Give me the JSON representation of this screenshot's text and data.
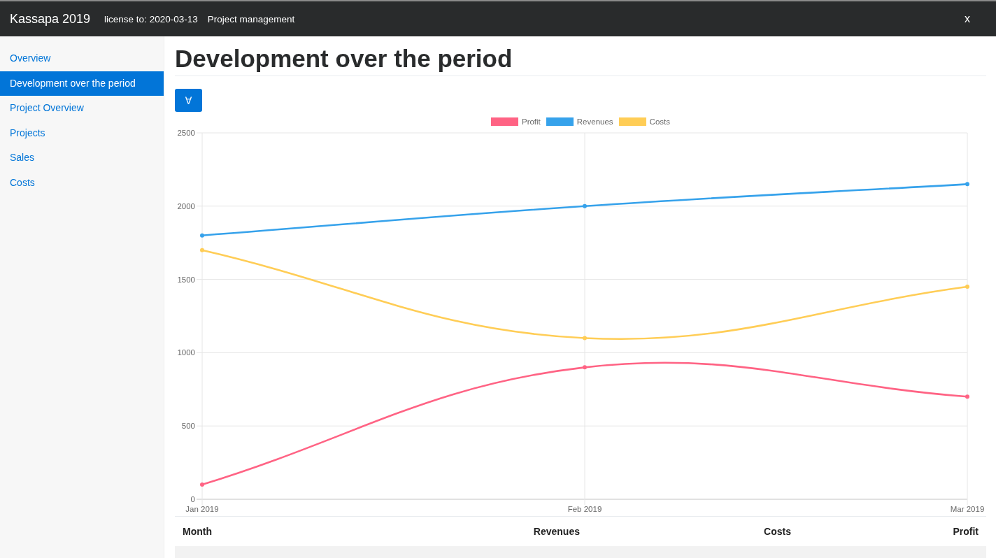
{
  "window": {
    "brand": "Kassapa 2019",
    "license": "license to: 2020-03-13",
    "module": "Project management",
    "close": "x"
  },
  "sidebar": {
    "items": [
      {
        "label": "Overview",
        "selected": false
      },
      {
        "label": "Development over the period",
        "selected": true
      },
      {
        "label": "Project Overview",
        "selected": false
      },
      {
        "label": "Projects",
        "selected": false
      },
      {
        "label": "Sales",
        "selected": false
      },
      {
        "label": "Costs",
        "selected": false
      }
    ]
  },
  "page": {
    "title": "Development over the period",
    "toggle_button": "∀",
    "chart_data": {
      "type": "line",
      "categories": [
        "Jan 2019",
        "Feb 2019",
        "Mar 2019"
      ],
      "series": [
        {
          "name": "Profit",
          "color": "#ff6384",
          "marker": true,
          "values": [
            100,
            900,
            700
          ]
        },
        {
          "name": "Revenues",
          "color": "#36a2eb",
          "marker": true,
          "values": [
            1800,
            2000,
            2150
          ]
        },
        {
          "name": "Costs",
          "color": "#ffcd56",
          "marker": true,
          "values": [
            1700,
            1100,
            1450
          ]
        }
      ],
      "ylim": [
        0,
        2500
      ],
      "yticks": [
        0,
        500,
        1000,
        1500,
        2000,
        2500
      ],
      "grid": true,
      "legend": "top"
    }
  },
  "table": {
    "columns": [
      "Month",
      "Revenues",
      "Costs",
      "Profit"
    ]
  }
}
